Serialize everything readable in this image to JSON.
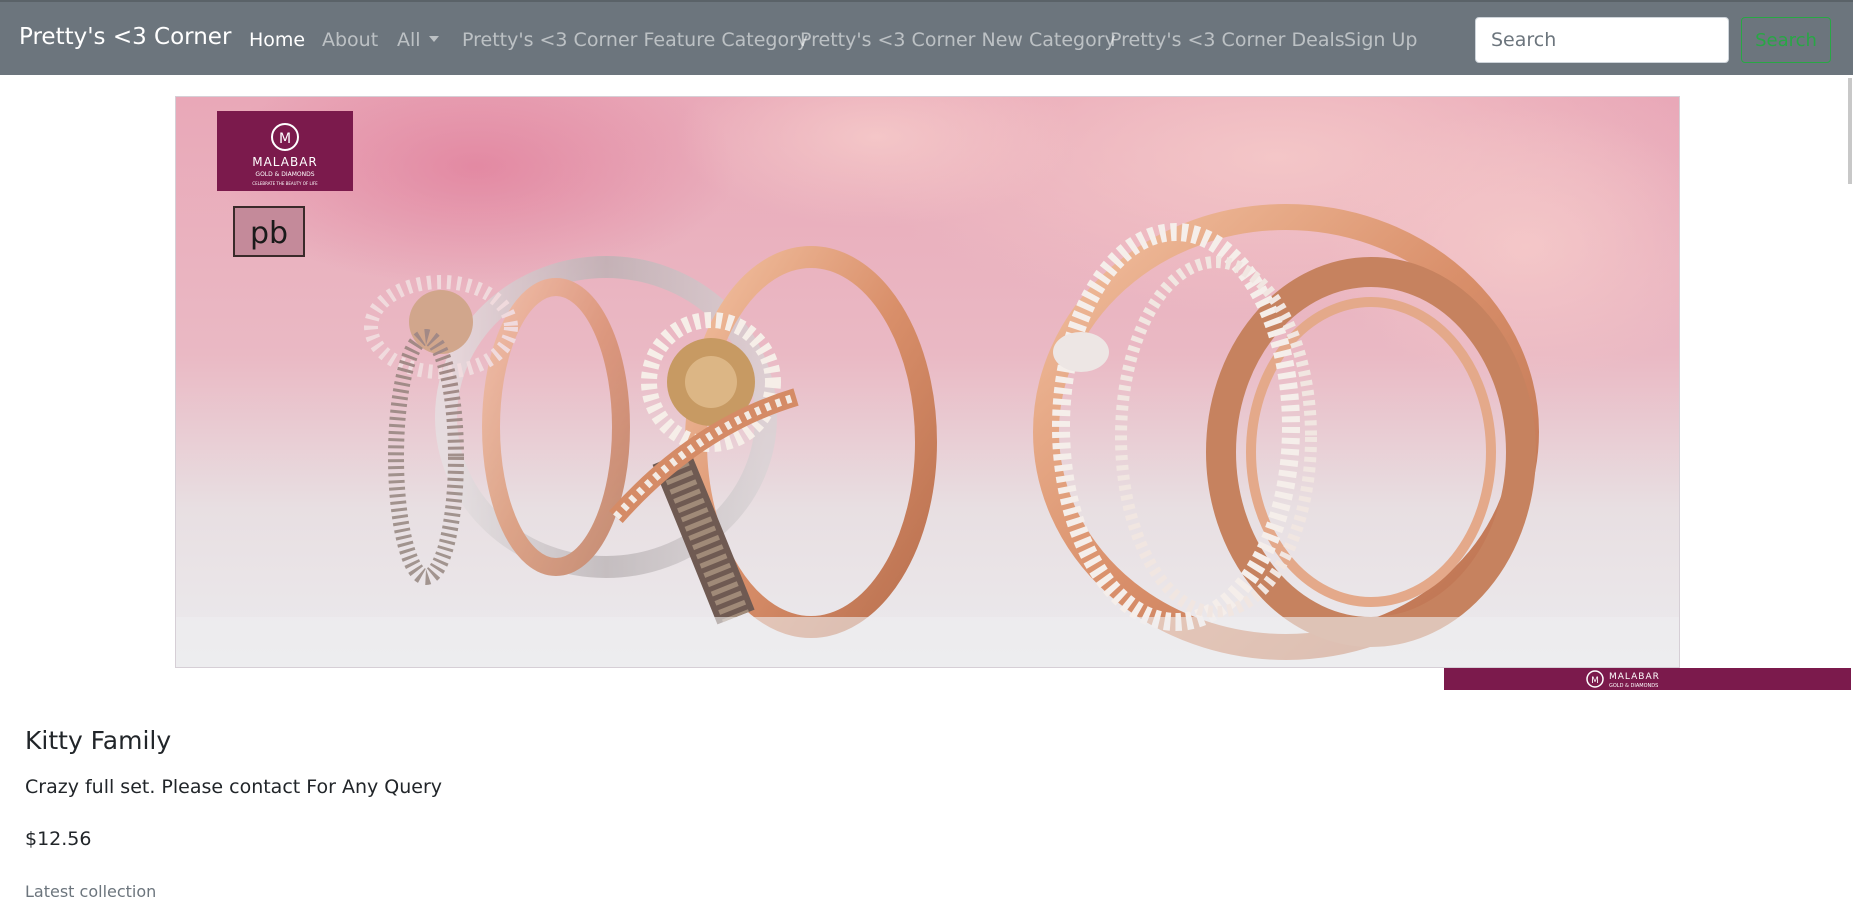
{
  "navbar": {
    "brand": "Pretty's <3 Corner",
    "links": [
      {
        "label": "Home",
        "active": true
      },
      {
        "label": "About",
        "active": false
      },
      {
        "label": "All",
        "active": false,
        "dropdown": true
      },
      {
        "label": "Pretty's <3 Corner Feature Category",
        "active": false
      },
      {
        "label": "Pretty's <3 Corner New Category",
        "active": false
      },
      {
        "label": "Pretty's <3 Corner Deals",
        "active": false
      },
      {
        "label": "Sign Up",
        "active": false
      }
    ],
    "search": {
      "placeholder": "Search",
      "value": "",
      "button_label": "Search"
    }
  },
  "hero": {
    "logo_primary": "MALABAR",
    "logo_secondary": "GOLD & DIAMONDS",
    "logo_tagline": "CELEBRATE THE BEAUTY OF LIFE",
    "logo_mark": "pb",
    "subject": "rose-gold diamond rings"
  },
  "product": {
    "title": "Kitty Family",
    "description": "Crazy full set. Please contact For Any Query",
    "price": "$12.56",
    "tagline": "Latest collection"
  },
  "colors": {
    "navbar_bg": "#6c757d",
    "search_button": "#28a745",
    "brand_badge": "#7b1a4c"
  }
}
